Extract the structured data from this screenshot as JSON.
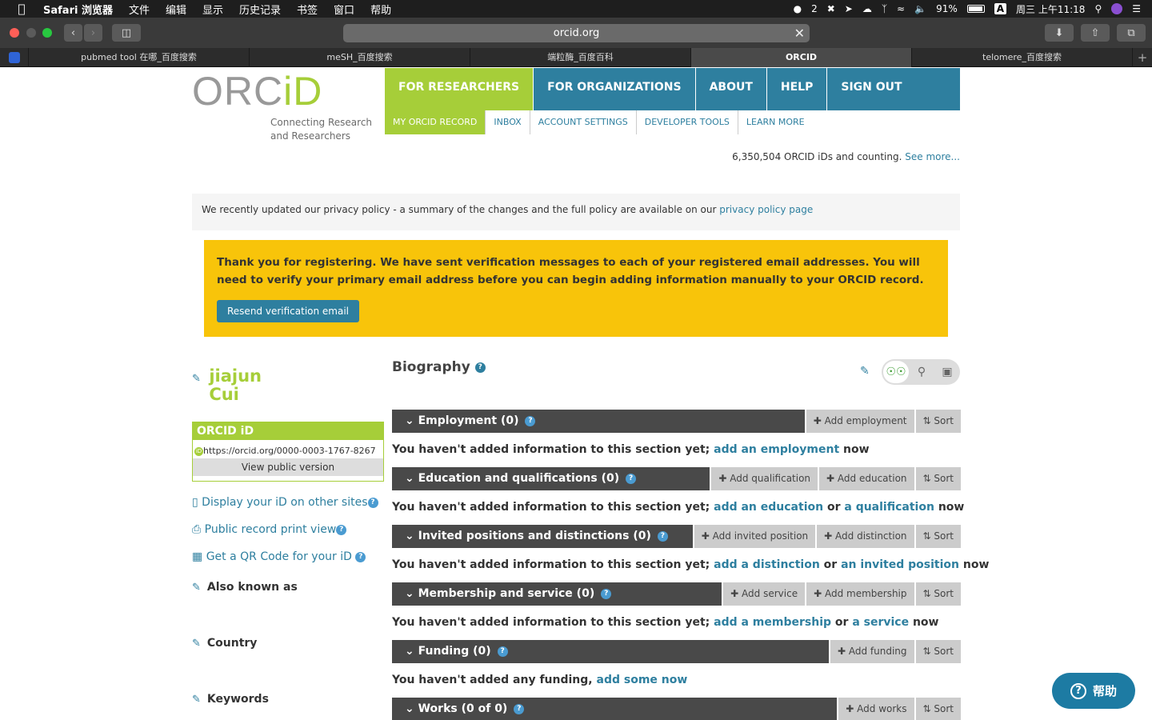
{
  "menubar": {
    "app": "Safari 浏览器",
    "items": [
      "文件",
      "编辑",
      "显示",
      "历史记录",
      "书签",
      "窗口",
      "帮助"
    ],
    "wechat_count": "2",
    "battery": "91%",
    "clock": "周三 上午11:18",
    "input_method": "A"
  },
  "browser": {
    "url": "orcid.org",
    "tabs": [
      "pubmed tool 在哪_百度搜索",
      "meSH_百度搜索",
      "端粒酶_百度百科",
      "ORCID",
      "telomere_百度搜索"
    ],
    "active_tab": 3
  },
  "site": {
    "logo_word": "ORC",
    "logo_id": "iD",
    "tagline": "Connecting Research and Researchers",
    "main_nav": [
      "FOR RESEARCHERS",
      "FOR ORGANIZATIONS",
      "ABOUT",
      "HELP",
      "SIGN OUT"
    ],
    "sub_nav": [
      "MY ORCID RECORD",
      "INBOX",
      "ACCOUNT SETTINGS",
      "DEVELOPER TOOLS",
      "LEARN MORE"
    ],
    "count_text": "6,350,504 ORCID iDs and counting.",
    "count_link": "See more..."
  },
  "privacy_notice": {
    "text": "We recently updated our privacy policy - a summary of the changes and the full policy are available on our",
    "link": "privacy policy page"
  },
  "verify": {
    "message": "Thank you for registering. We have sent verification messages to each of your registered email addresses. You will need to verify your primary email address before you can begin adding information manually to your ORCID record.",
    "button": "Resend verification email"
  },
  "profile": {
    "first_name": "jiajun",
    "last_name": "Cui",
    "orcid_header": "ORCID iD",
    "orcid_uri": "https://orcid.org/0000-0003-1767-8267",
    "view_public": "View public version",
    "links": [
      "Display your iD on other sites",
      "Public record print view",
      "Get a QR Code for your iD"
    ],
    "sections": [
      "Also known as",
      "Country",
      "Keywords"
    ]
  },
  "biography": {
    "title": "Biography"
  },
  "sections": [
    {
      "title": "Employment (0)",
      "actions": [
        "Add employment",
        "Sort"
      ],
      "empty_pre": "You haven't added information to this section yet;",
      "links": [
        "add an employment"
      ],
      "joiners": [],
      "empty_post": "now"
    },
    {
      "title": "Education and qualifications (0)",
      "actions": [
        "Add qualification",
        "Add education",
        "Sort"
      ],
      "empty_pre": "You haven't added information to this section yet;",
      "links": [
        "add an education",
        "a qualification"
      ],
      "joiners": [
        "or"
      ],
      "empty_post": "now"
    },
    {
      "title": "Invited positions and distinctions (0)",
      "actions": [
        "Add invited position",
        "Add distinction",
        "Sort"
      ],
      "empty_pre": "You haven't added information to this section yet;",
      "links": [
        "add a distinction",
        "an invited position"
      ],
      "joiners": [
        "or"
      ],
      "empty_post": "now"
    },
    {
      "title": "Membership and service (0)",
      "actions": [
        "Add service",
        "Add membership",
        "Sort"
      ],
      "empty_pre": "You haven't added information to this section yet;",
      "links": [
        "add a membership",
        "a service"
      ],
      "joiners": [
        "or"
      ],
      "empty_post": "now"
    },
    {
      "title": "Funding (0)",
      "actions": [
        "Add funding",
        "Sort"
      ],
      "empty_pre": "You haven't added any funding,",
      "links": [
        "add some now"
      ],
      "joiners": [],
      "empty_post": ""
    },
    {
      "title": "Works (0 of 0)",
      "actions": [
        "Add works",
        "Sort"
      ]
    }
  ],
  "help_widget": {
    "label": "帮助"
  }
}
